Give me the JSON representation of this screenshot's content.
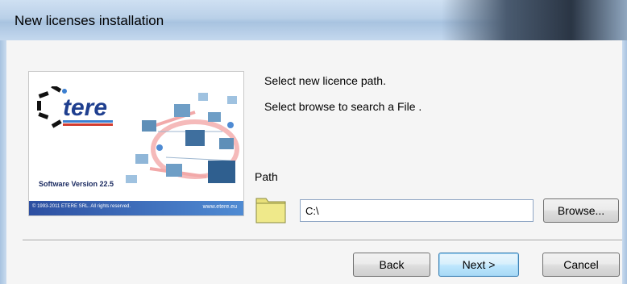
{
  "window": {
    "title": "New licenses installation"
  },
  "splash": {
    "logo_text": "tere",
    "version_text": "Software Version  22.5",
    "copyright_text": "© 1993-2011 ETERE SRL. All rights reserved.",
    "website_text": "www.etere.eu"
  },
  "instructions": {
    "line1": "Select new licence path.",
    "line2": "Select browse to search a File ."
  },
  "path": {
    "label": "Path",
    "value": "C:\\",
    "browse_label": "Browse..."
  },
  "buttons": {
    "back": "Back",
    "next": "Next >",
    "cancel": "Cancel"
  },
  "icons": {
    "folder": "folder-icon",
    "logo": "etere-logo-icon",
    "network": "network-illustration"
  }
}
